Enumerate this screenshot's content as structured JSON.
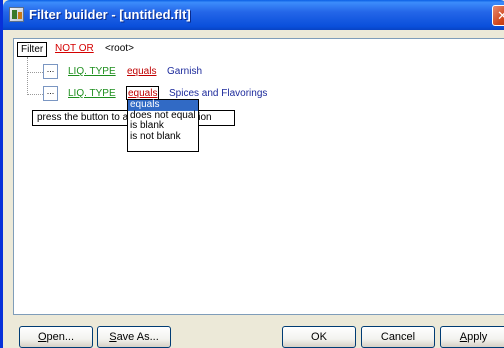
{
  "window": {
    "title": "Filter builder - [untitled.flt]",
    "close_glyph": "✕"
  },
  "tree": {
    "root_tag": "Filter",
    "root_operator": "NOT OR",
    "root_label": "<root>",
    "conditions": [
      {
        "button": "...",
        "field": "LIQ. TYPE",
        "comparison": "equals",
        "value": "Garnish"
      },
      {
        "button": "...",
        "field": "LIQ. TYPE",
        "comparison": "equals",
        "value": "Spices and Flavorings"
      }
    ],
    "hint": "press the button to add a new condition"
  },
  "dropdown": {
    "options": [
      "equals",
      "does not equal",
      "is blank",
      "is not blank"
    ],
    "selected_index": 0
  },
  "buttons": {
    "open": {
      "prefix": "",
      "mnemonic": "O",
      "rest": "pen..."
    },
    "save_as": {
      "prefix": "",
      "mnemonic": "S",
      "rest": "ave As..."
    },
    "ok": "OK",
    "cancel": "Cancel",
    "apply": {
      "prefix": "",
      "mnemonic": "A",
      "rest": "pply"
    }
  },
  "colors": {
    "title_bar": "#2466e8",
    "operator": "#d40000",
    "field": "#1e8f1e",
    "value": "#1c2a9c",
    "selection": "#316ac5"
  }
}
